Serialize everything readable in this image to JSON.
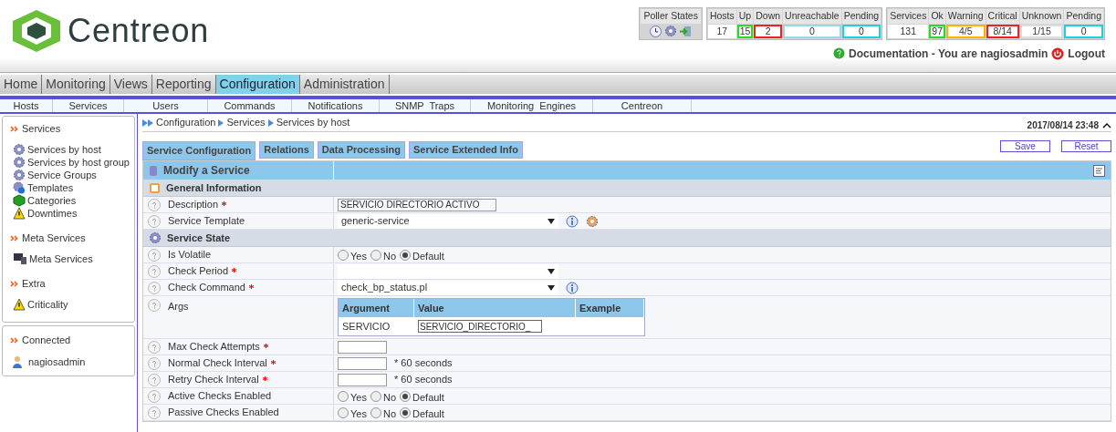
{
  "logo": {
    "text": "Centreon"
  },
  "poller_states": {
    "title": "Poller States"
  },
  "host_counts": [
    {
      "label": "Hosts",
      "value": "17"
    },
    {
      "label": "Up",
      "value": "15",
      "color": "#22dd22"
    },
    {
      "label": "Down",
      "value": "2",
      "color": "#ee2222"
    },
    {
      "label": "Unreachable",
      "value": "0",
      "color": "#99d8e8"
    },
    {
      "label": "Pending",
      "value": "0",
      "color": "#22d0d8"
    }
  ],
  "service_counts": [
    {
      "label": "Services",
      "value": "131"
    },
    {
      "label": "Ok",
      "value": "97",
      "color": "#22dd22"
    },
    {
      "label": "Warning",
      "value": "4/5",
      "color": "#ffb000"
    },
    {
      "label": "Critical",
      "value": "8/14",
      "color": "#ee2222"
    },
    {
      "label": "Unknown",
      "value": "1/15",
      "color": "#dddddd"
    },
    {
      "label": "Pending",
      "value": "0",
      "color": "#22d0d8"
    }
  ],
  "user_bar": {
    "documentation": "Documentation - You are nagiosadmin",
    "logout": "Logout"
  },
  "menu": [
    {
      "label": "Home",
      "selected": false
    },
    {
      "label": "Monitoring",
      "selected": false
    },
    {
      "label": "Views",
      "selected": false
    },
    {
      "label": "Reporting",
      "selected": false
    },
    {
      "label": "Configuration",
      "selected": true
    },
    {
      "label": "Administration",
      "selected": false
    }
  ],
  "submenu": [
    "Hosts",
    "Services",
    "Users",
    "Commands",
    "Notifications",
    "SNMP  Traps",
    "Monitoring  Engines",
    "Centreon"
  ],
  "sidebar": {
    "sections": [
      {
        "title": "Services",
        "items": [
          {
            "label": "Services by host",
            "kind": "gear"
          },
          {
            "label": "Services by host group",
            "kind": "gear"
          },
          {
            "label": "Service Groups",
            "kind": "gears"
          },
          {
            "label": "Templates",
            "kind": "gear-info"
          },
          {
            "label": "Categories",
            "kind": "cube"
          },
          {
            "label": "Downtimes",
            "kind": "warning"
          }
        ]
      },
      {
        "title": "Meta Services",
        "items": [
          {
            "label": "Meta Services",
            "kind": "computer"
          }
        ]
      },
      {
        "title": "Extra",
        "items": [
          {
            "label": "Criticality",
            "kind": "warning"
          }
        ]
      }
    ],
    "connected": {
      "title": "Connected",
      "user": "nagiosadmin"
    }
  },
  "breadcrumb": [
    "Configuration",
    "Services",
    "Services by host"
  ],
  "datetime": "2017/08/14 23:48",
  "tabs": [
    {
      "label": "Service Configuration",
      "selected": true
    },
    {
      "label": "Relations",
      "selected": false
    },
    {
      "label": "Data Processing",
      "selected": false
    },
    {
      "label": "Service Extended Info",
      "selected": false
    }
  ],
  "buttons": [
    "Save",
    "Reset"
  ],
  "form": {
    "title": "Modify a Service",
    "sections": [
      {
        "title": "General Information",
        "kind": "info",
        "rows": [
          {
            "kind": "text",
            "label": "Description",
            "required": true,
            "value": "SERVICIO DIRECTORIO ACTIVO"
          },
          {
            "kind": "select",
            "label": "Service Template",
            "required": false,
            "value": "generic-service",
            "icons": true
          }
        ]
      },
      {
        "title": "Service State",
        "kind": "gear",
        "rows": [
          {
            "kind": "radio",
            "label": "Is Volatile",
            "required": false,
            "options": [
              {
                "label": "Yes",
                "selected": false
              },
              {
                "label": "No",
                "selected": false
              },
              {
                "label": "Default",
                "selected": true
              }
            ]
          },
          {
            "kind": "select",
            "label": "Check Period",
            "required": true,
            "value": "",
            "icons": false
          },
          {
            "kind": "select",
            "label": "Check Command",
            "required": true,
            "value": "check_bp_status.pl",
            "icons": true
          },
          {
            "kind": "args",
            "label": "Args",
            "required": false,
            "columns": [
              "Argument",
              "Value",
              "Example"
            ],
            "rows": [
              {
                "argument": "SERVICIO",
                "value": "SERVICIO_DIRECTORIO_"
              }
            ]
          },
          {
            "kind": "number",
            "label": "Max Check Attempts",
            "required": true
          },
          {
            "kind": "number",
            "label": "Normal Check Interval",
            "required": true,
            "suffix": "* 60 seconds"
          },
          {
            "kind": "number",
            "label": "Retry Check Interval",
            "required": true,
            "suffix": "* 60 seconds"
          },
          {
            "kind": "radio",
            "label": "Active Checks Enabled",
            "required": false,
            "options": [
              {
                "label": "Yes",
                "selected": false
              },
              {
                "label": "No",
                "selected": false
              },
              {
                "label": "Default",
                "selected": true
              }
            ]
          },
          {
            "kind": "radio",
            "label": "Passive Checks Enabled",
            "required": false,
            "options": [
              {
                "label": "Yes",
                "selected": false
              },
              {
                "label": "No",
                "selected": false
              },
              {
                "label": "Default",
                "selected": true
              }
            ]
          }
        ]
      }
    ]
  }
}
